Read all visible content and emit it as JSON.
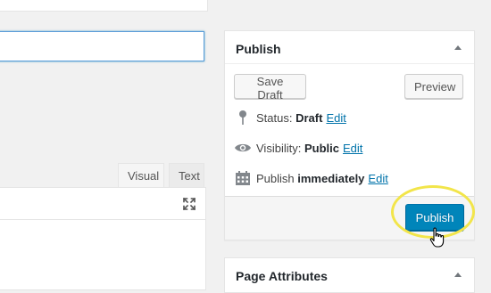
{
  "editor": {
    "title_value": "",
    "tabs": [
      {
        "label": "Visual"
      },
      {
        "label": "Text"
      }
    ],
    "fullscreen_icon": "fullscreen-expand-icon"
  },
  "publish_box": {
    "title": "Publish",
    "save_draft_label": "Save Draft",
    "preview_label": "Preview",
    "status": {
      "label": "Status:",
      "value": "Draft",
      "edit": "Edit",
      "icon": "pin-icon"
    },
    "visibility": {
      "label": "Visibility:",
      "value": "Public",
      "edit": "Edit",
      "icon": "eye-icon"
    },
    "schedule": {
      "label": "Publish",
      "value": "immediately",
      "edit": "Edit",
      "icon": "calendar-icon"
    },
    "publish_label": "Publish"
  },
  "page_attributes": {
    "title": "Page Attributes"
  },
  "colors": {
    "primary": "#0085ba",
    "link": "#0073aa",
    "highlight": "#f2e54a"
  }
}
